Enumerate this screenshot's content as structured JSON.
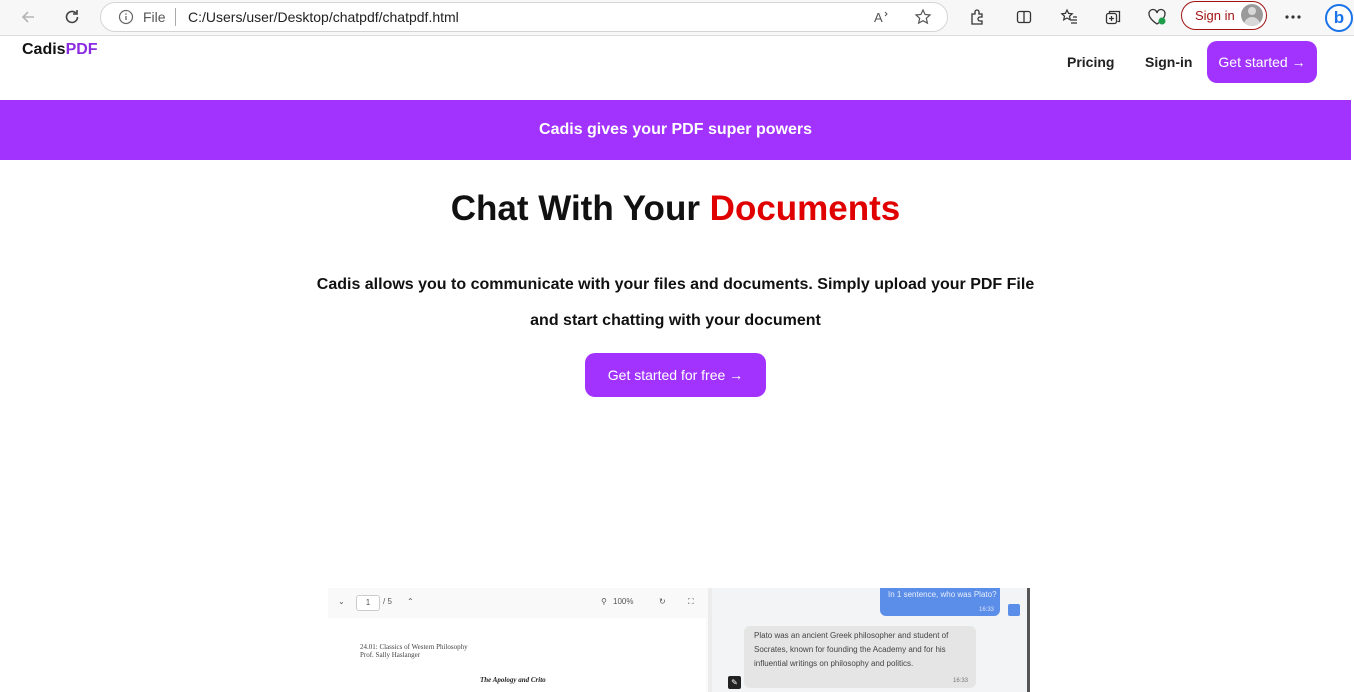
{
  "browser": {
    "scheme_label": "File",
    "url": "C:/Users/user/Desktop/chatpdf/chatpdf.html",
    "signin_label": "Sign in",
    "bing_label": "b"
  },
  "site": {
    "logo_main": "Cadis",
    "logo_accent": "PDF",
    "nav": {
      "pricing": "Pricing",
      "signin": "Sign-in",
      "get_started": "Get started →"
    },
    "banner": "Cadis gives your PDF super powers",
    "hero": {
      "title_main": "Chat With Your ",
      "title_accent": "Documents",
      "desc_line1": "Cadis allows you to communicate with your files and documents. Simply upload your PDF File",
      "desc_line2": "and start chatting with your document",
      "cta": "Get started for free →"
    },
    "preview": {
      "page_current": "1",
      "page_total": "/ 5",
      "zoom": "100%",
      "pdf_line1": "24.01: Classics of Western Philosophy",
      "pdf_line2": "Prof. Sally Haslanger",
      "pdf_title": "The Apology and Crito",
      "user_msg": "In 1 sentence, who was Plato?",
      "user_time": "16:33",
      "bot_msg": "Plato was an ancient Greek philosopher and student of Socrates, known for founding the Academy and for his influential writings on philosophy and politics.",
      "bot_time": "16:33"
    }
  },
  "colors": {
    "accent": "#a233ff",
    "logo_accent": "#8a2be2",
    "title_accent": "#e00000"
  }
}
